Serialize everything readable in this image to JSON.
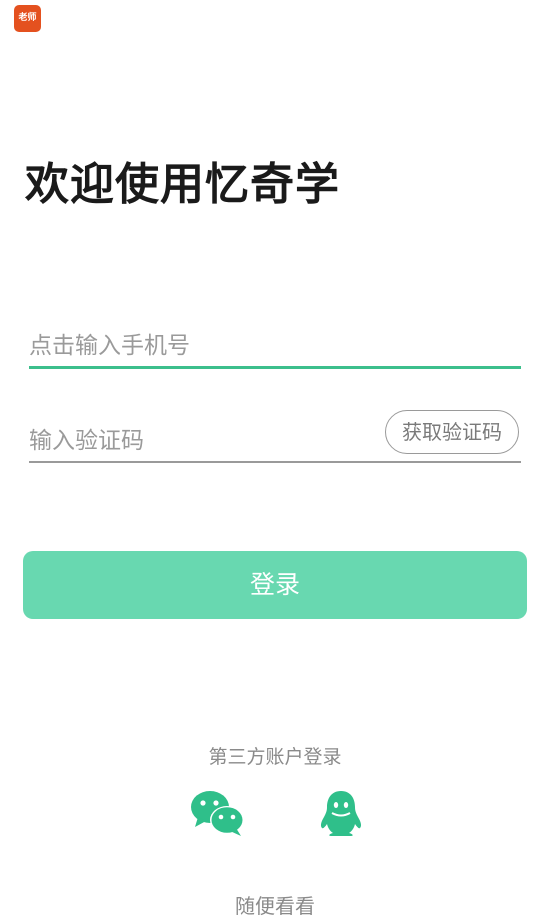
{
  "app_badge": {
    "label": "老师",
    "color": "#e4511f"
  },
  "welcome_title": "欢迎使用忆奇学",
  "phone_field": {
    "placeholder": "点击输入手机号",
    "value": ""
  },
  "code_field": {
    "placeholder": "输入验证码",
    "value": ""
  },
  "get_code_button": "获取验证码",
  "login_button": "登录",
  "third_party": {
    "label": "第三方账户登录",
    "providers": [
      {
        "icon": "wechat-icon"
      },
      {
        "icon": "qq-icon"
      }
    ]
  },
  "browse_link": "随便看看",
  "colors": {
    "accent": "#3cbf8c",
    "button": "#68d8b0",
    "icon": "#2fbf8a"
  }
}
